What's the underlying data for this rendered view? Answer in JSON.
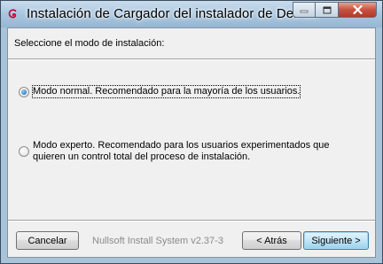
{
  "window": {
    "title": "Instalación de Cargador del instalador de Debian",
    "icon": "debian-swirl-icon",
    "caption_buttons": [
      "minimize-icon",
      "maximize-icon",
      "close-icon"
    ]
  },
  "page": {
    "prompt": "Seleccione el modo de instalación:",
    "options": [
      {
        "label": "Modo normal. Recomendado para la mayoría de los usuarios.",
        "checked": true
      },
      {
        "label": "Modo experto. Recomendado para los usuarios experimentados que quieren un control total del proceso de instalación.",
        "checked": false
      }
    ]
  },
  "footer": {
    "cancel_label": "Cancelar",
    "branding": "Nullsoft Install System v2.37-3",
    "back_label": "< Atrás",
    "next_label": "Siguiente >"
  },
  "colors": {
    "accent": "#3c7fb1",
    "title_glass": "#a9c6df",
    "close_button": "#c75140"
  }
}
